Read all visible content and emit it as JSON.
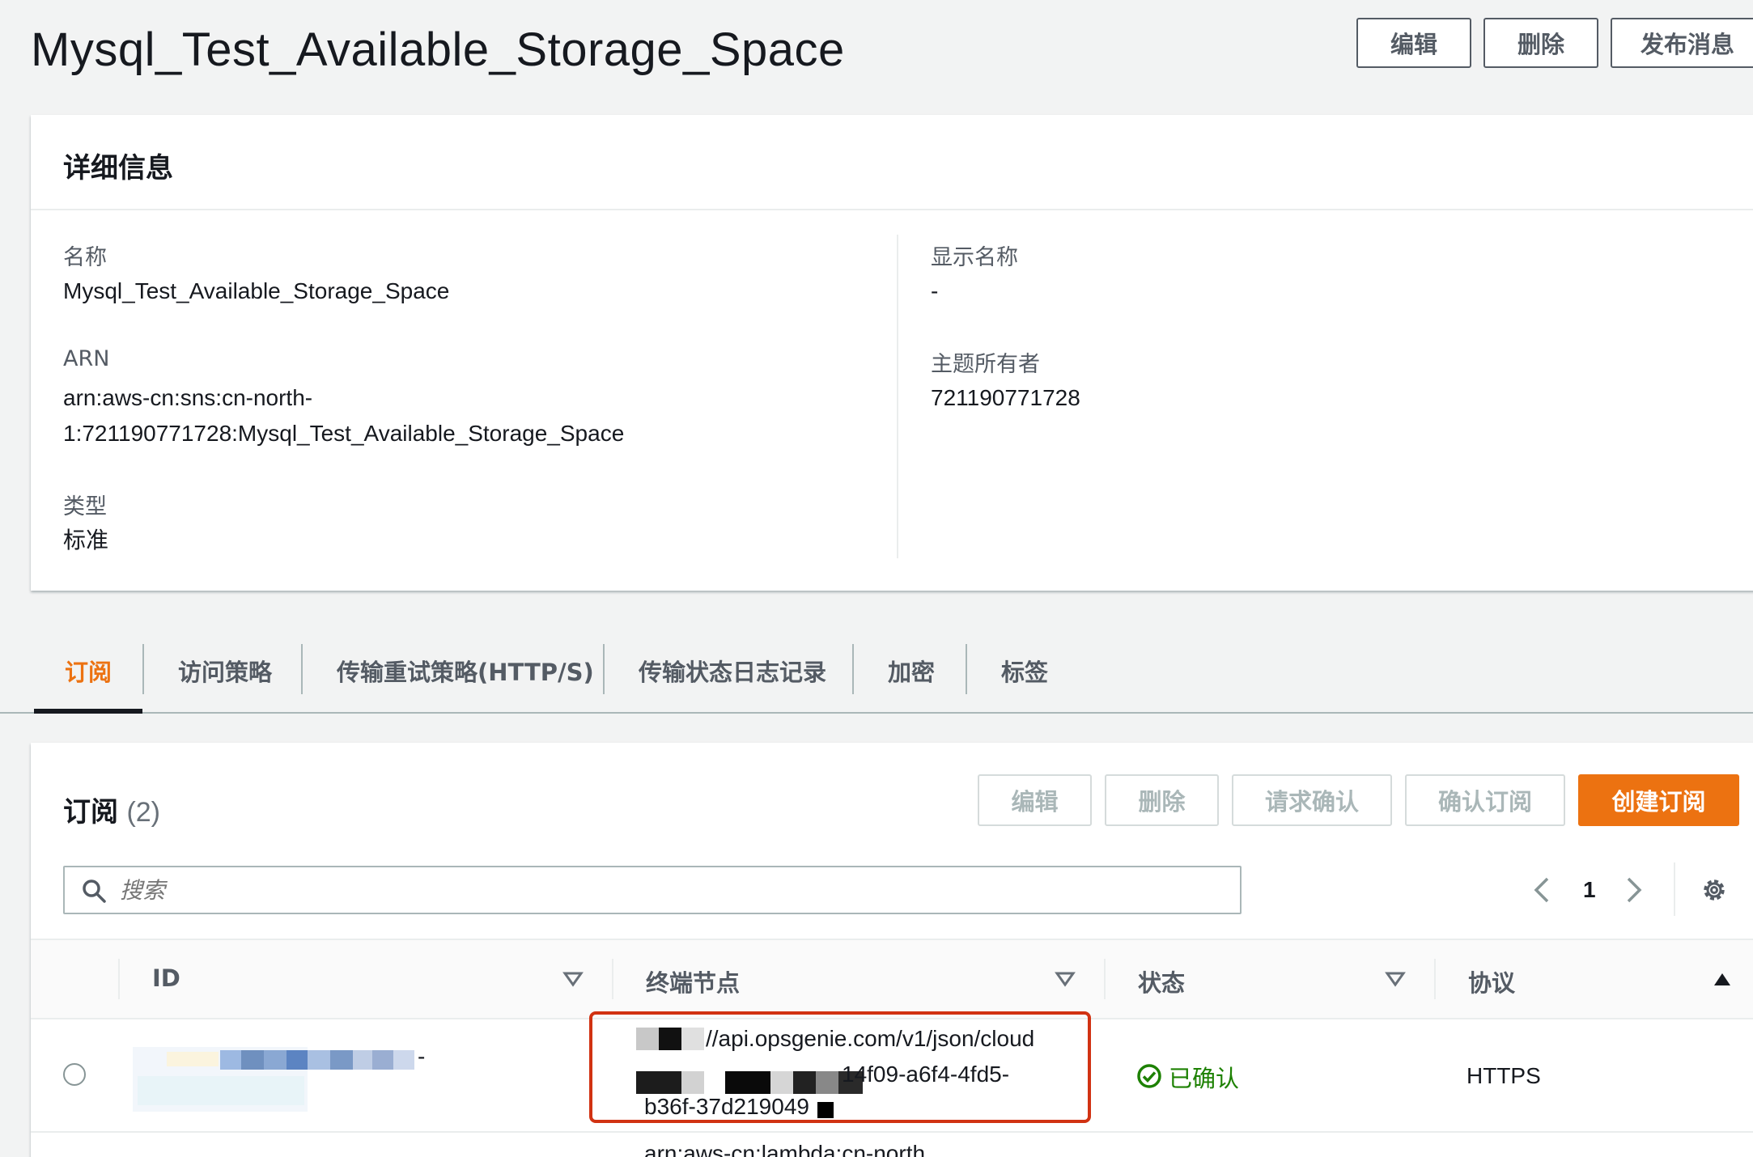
{
  "title": "Mysql_Test_Available_Storage_Space",
  "header_actions": {
    "edit": "编辑",
    "delete": "删除",
    "publish": "发布消息"
  },
  "details": {
    "heading": "详细信息",
    "name_label": "名称",
    "name_value": "Mysql_Test_Available_Storage_Space",
    "arn_label": "ARN",
    "arn_line1": "arn:aws-cn:sns:cn-north-",
    "arn_line2": "1:721190771728:Mysql_Test_Available_Storage_Space",
    "type_label": "类型",
    "type_value": "标准",
    "display_name_label": "显示名称",
    "display_name_value": "-",
    "owner_label": "主题所有者",
    "owner_value": "721190771728"
  },
  "tabs": [
    {
      "label": "订阅",
      "active": true
    },
    {
      "label": "访问策略"
    },
    {
      "label": "传输重试策略(HTTP/S)"
    },
    {
      "label": "传输状态日志记录"
    },
    {
      "label": "加密"
    },
    {
      "label": "标签"
    }
  ],
  "subscriptions": {
    "heading": "订阅",
    "count": "(2)",
    "actions": {
      "edit": "编辑",
      "delete": "删除",
      "request_confirm": "请求确认",
      "confirm": "确认订阅",
      "create": "创建订阅"
    },
    "search_placeholder": "搜索",
    "page_number": "1",
    "columns": {
      "id": "ID",
      "endpoint": "终端节点",
      "status": "状态",
      "protocol": "协议"
    },
    "rows": [
      {
        "id_suffix": "-",
        "endpoint_line1": "//api.opsgenie.com/v1/json/cloud",
        "endpoint_line2": "14f09-a6f4-4fd5-",
        "endpoint_line3": "b36f-37d219049",
        "status": "已确认",
        "protocol": "HTTPS"
      },
      {
        "endpoint_line1": "arn:aws-cn:lambda:cn-north"
      }
    ]
  },
  "colors": {
    "accent": "#ec7211",
    "success": "#1d8102",
    "highlight": "#d13212"
  },
  "icons": [
    "search-icon",
    "chevron-left-icon",
    "chevron-right-icon",
    "gear-icon",
    "sort-down-icon",
    "sort-up-icon",
    "check-circle-icon"
  ]
}
